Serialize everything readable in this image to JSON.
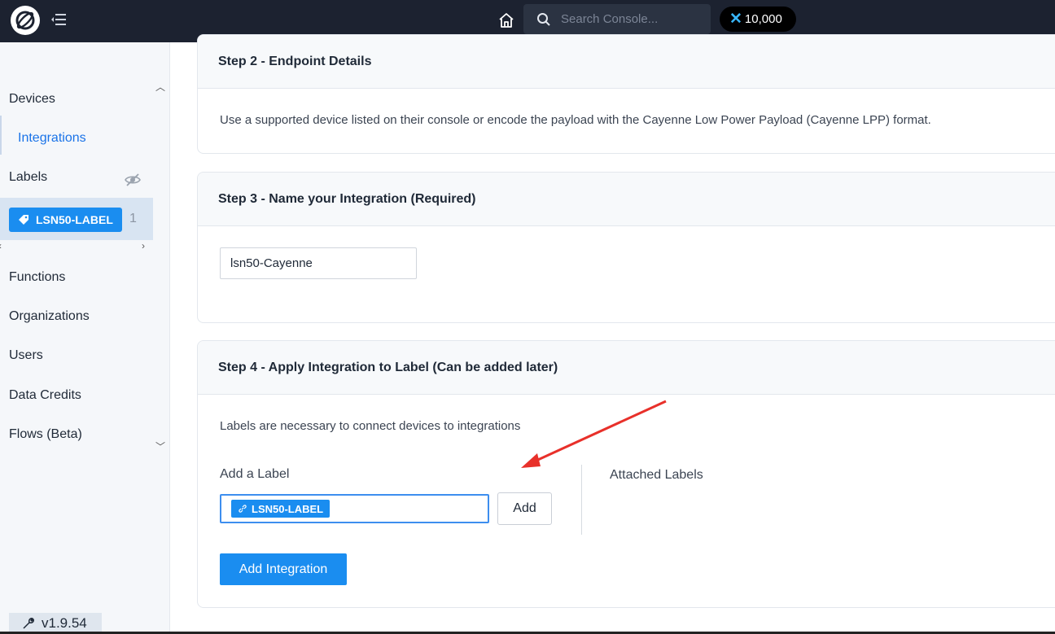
{
  "topbar": {
    "search_placeholder": "Search Console...",
    "credits_value": "10,000"
  },
  "sidebar": {
    "devices": "Devices",
    "integrations": "Integrations",
    "labels": "Labels",
    "label_chip": "LSN50-LABEL",
    "label_count": "1",
    "functions": "Functions",
    "organizations": "Organizations",
    "users": "Users",
    "data_credits": "Data Credits",
    "flows": "Flows (Beta)",
    "version": "v1.9.54"
  },
  "step2": {
    "title": "Step 2 - Endpoint Details",
    "description": "Use a supported device listed on their console or encode the payload with the Cayenne Low Power Payload (Cayenne LPP) format."
  },
  "step3": {
    "title": "Step 3 - Name your Integration (Required)",
    "name_value": "lsn50-Cayenne"
  },
  "step4": {
    "title": "Step 4 - Apply Integration to Label (Can be added later)",
    "description": "Labels are necessary to connect devices to integrations",
    "add_label_title": "Add a Label",
    "selected_label": "LSN50-LABEL",
    "add_button": "Add",
    "attached_labels_title": "Attached Labels",
    "submit_button": "Add Integration"
  },
  "colors": {
    "topbar": "#1c2230",
    "accent": "#1a8df0",
    "annotation_arrow": "#e8302a"
  }
}
